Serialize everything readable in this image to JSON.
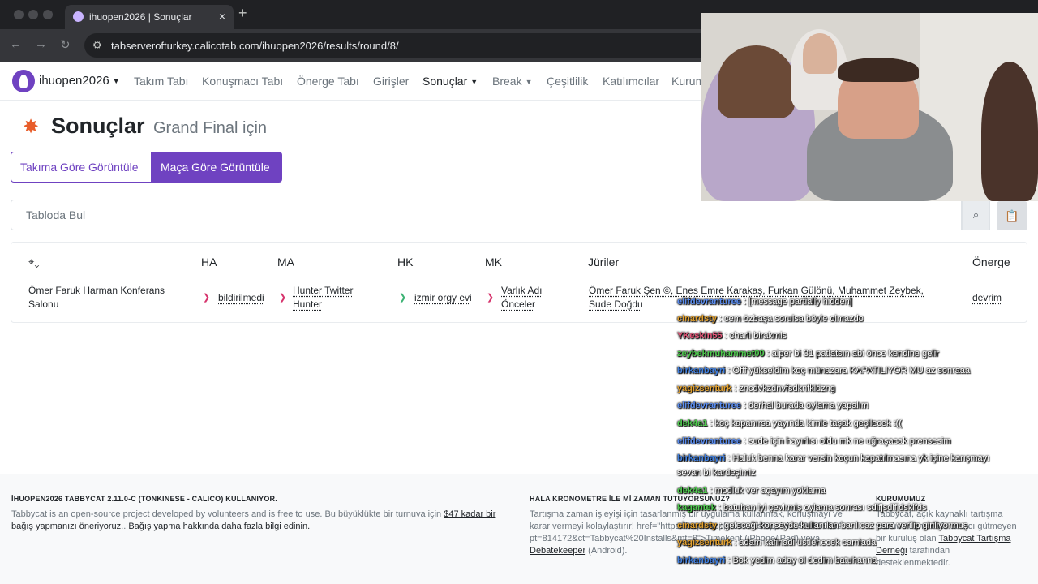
{
  "browser": {
    "tab_title": "ihuopen2026 | Sonuçlar",
    "tab_close": "×",
    "new_tab": "+",
    "url": "tabserverofturkey.calicotab.com/ihuopen2026/results/round/8/"
  },
  "nav": {
    "brand": "ihuopen2026",
    "items": [
      "Takım Tabı",
      "Konuşmacı Tabı",
      "Önerge Tabı",
      "Girişler",
      "Sonuçlar",
      "Break",
      "Çeşitlilik",
      "Katılımcılar",
      "Kurum"
    ]
  },
  "page": {
    "title": "Sonuçlar",
    "subtitle": "Grand Final için",
    "view_team_label": "Takıma Göre Görüntüle",
    "view_debate_label": "Maça Göre Görüntüle",
    "search_placeholder": "Tabloda Bul"
  },
  "table": {
    "headers": {
      "ha": "HA",
      "ma": "MA",
      "hk": "HK",
      "mk": "MK",
      "judges": "Jüriler",
      "motion": "Önerge"
    },
    "row": {
      "venue": "Ömer Faruk Harman Konferans Salonu",
      "ha": "bildirilmedi",
      "ma": "Hunter Twitter Hunter",
      "hk": "izmir orgy evi",
      "mk": "Varlık Adı Önceler",
      "judges": "Ömer Faruk Şen ©, Enes Emre Karakaş, Furkan Gülönü, Muhammet Zeybek, Sude Doğdu",
      "motion": "devrim"
    }
  },
  "footer": {
    "col1_head": "İHUOPEN2026 TABBYCAT 2.11.0-C (TONKINESE - CALICO) KULLANIYOR.",
    "col1_text": "Tabbycat is an open-source project developed by volunteers and is free to use. Bu büyüklükte bir turnuva için ",
    "col1_amount": "$47 kadar bir bağış yapmanızı öneriyoruz.",
    "col1_sep": ". ",
    "col1_link": "Bağış yapma hakkında daha fazla bilgi edinin.",
    "col2_head": "HALA KRONOMETRE İLE Mİ ZAMAN TUTUYORSUNUZ?",
    "col2_text": "Tartışma zaman işleyişi için tasarlanmış bir uygulama kullanmak, konuşmayı ve karar vermeyi kolaylaştırır! href=\"https://apps.apple.com/us/app/id1156065589?pt=814172&ct=Tabbycat%20Installs&mt=8\">Timekent (iPhone/iPad) veya ",
    "col2_link": "Debatekeeper",
    "col2_tail": " (Android).",
    "col3_head": "KURUMUMUZ",
    "col3_text": "Tabbycat, açık kaynaklı tartışma yazılımı sunan kâr amacı gütmeyen bir kuruluş olan ",
    "col3_link": "Tabbycat Tartışma Derneği",
    "col3_tail": " tarafından desteklenmektedir."
  },
  "chat": [
    {
      "user": "elifdevranturee",
      "msg": ": [message partially hidden]",
      "color": "#5b8def"
    },
    {
      "user": "cinardsty",
      "msg": ": cem özbaşa sorulsa böyle olmazdo",
      "color": "#e0a030"
    },
    {
      "user": "YKeskin55",
      "msg": ": charli birakmis",
      "color": "#e8567a"
    },
    {
      "user": "zeybekmuhammet00",
      "msg": ": alper bi 31 patlatsın abi önce kendine gelir",
      "color": "#4ec94e"
    },
    {
      "user": "birkanbayri",
      "msg": ": Offf yükseldim koç münazara KAPATILIYOR MU az sonraaa",
      "color": "#3f7fe0"
    },
    {
      "user": "yagizsenturk",
      "msg": ": zncdvkzdnvfsdknfkldzng",
      "color": "#e0a030"
    },
    {
      "user": "elifdevranturee",
      "msg": ": derhal burada oylama yapalım",
      "color": "#5b8def"
    },
    {
      "user": "dek4a1",
      "msg": ": koç kapanırsa yayında kimle taşak geçilecek :((",
      "color": "#4ec94e"
    },
    {
      "user": "elifdevranturee",
      "msg": ": sude için hayırlısı oldu mk ne uğraşacak prensesim",
      "color": "#5b8def"
    },
    {
      "user": "birkanbayri",
      "msg": ": Haluk benna karar versin koçun kapatılmasına yk içine karışmayı",
      "color": "#3f7fe0"
    },
    {
      "user": "",
      "msg": "sevan bi kardeşimiz",
      "color": "#ffffff"
    },
    {
      "user": "dek4a1",
      "msg": ": modluk ver açayım yoklama",
      "color": "#4ec94e"
    },
    {
      "user": "kagantek",
      "msg": ": batuhan iyi çevirmiş oylama sonrası sdlfjsdlfjdsklfds",
      "color": "#4ec94e"
    },
    {
      "user": "cinardsty",
      "msg": ": geleceği konseyde kullanılan banlıcaz para verilip giriliyormuş",
      "color": "#e0a030"
    },
    {
      "user": "yagizsenturk",
      "msg": ": adam kafinadi üstlenecek camiada",
      "color": "#e0a030"
    },
    {
      "user": "birkanbayri",
      "msg": ": Bok yedim aday ol dedim batuhanna",
      "color": "#3f7fe0"
    }
  ]
}
